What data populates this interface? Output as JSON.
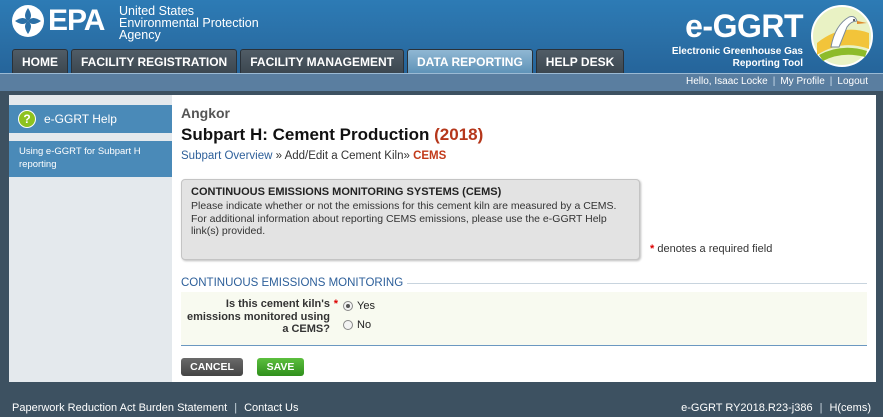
{
  "header": {
    "agency_line1": "United States",
    "agency_line2": "Environmental Protection",
    "agency_line3": "Agency",
    "logo_text": "EPA",
    "app_title": "e-GGRT",
    "app_subtitle_line1": "Electronic Greenhouse Gas",
    "app_subtitle_line2": "Reporting Tool"
  },
  "nav": {
    "tabs": [
      {
        "label": "HOME",
        "active": false
      },
      {
        "label": "FACILITY REGISTRATION",
        "active": false
      },
      {
        "label": "FACILITY MANAGEMENT",
        "active": false
      },
      {
        "label": "DATA REPORTING",
        "active": true
      },
      {
        "label": "HELP DESK",
        "active": false
      }
    ]
  },
  "user_bar": {
    "greeting": "Hello, Isaac Locke",
    "profile_link": "My Profile",
    "logout_link": "Logout"
  },
  "sidebar": {
    "help_icon": "?",
    "help_title": "e-GGRT Help",
    "help_link": "Using e-GGRT for Subpart H reporting"
  },
  "main": {
    "facility_name": "Angkor",
    "page_title": "Subpart H: Cement Production",
    "page_year": "(2018)",
    "breadcrumb": {
      "link": "Subpart Overview",
      "sep1": " » ",
      "middle": "Add/Edit a Cement Kiln",
      "sep2": "» ",
      "current": "CEMS"
    },
    "info_box": {
      "title": "CONTINUOUS EMISSIONS MONITORING SYSTEMS (CEMS)",
      "body": "Please indicate whether or not the emissions for this cement kiln are measured by a CEMS. For additional information about reporting CEMS emissions, please use the e-GGRT Help link(s) provided."
    },
    "required_star": "*",
    "required_note": " denotes a required field",
    "section_title": "CONTINUOUS EMISSIONS MONITORING",
    "question": {
      "label": "Is this cement kiln's emissions monitored using a CEMS?",
      "options": [
        {
          "label": "Yes",
          "selected": false
        },
        {
          "label": "No",
          "selected": false
        }
      ]
    },
    "buttons": {
      "cancel_label": "CANCEL",
      "save_label": "SAVE"
    }
  },
  "footer": {
    "burden_link": "Paperwork Reduction Act Burden Statement",
    "contact_link": "Contact Us",
    "version": "e-GGRT RY2018.R23-j386",
    "page_code": "H(cems)"
  },
  "colors": {
    "header_blue": "#2a6fa6",
    "active_tab": "#5f93b8",
    "title_year": "#b5371b",
    "link_blue": "#2d5f9a",
    "save_green": "#2f8f1c",
    "required_red": "#d00"
  }
}
